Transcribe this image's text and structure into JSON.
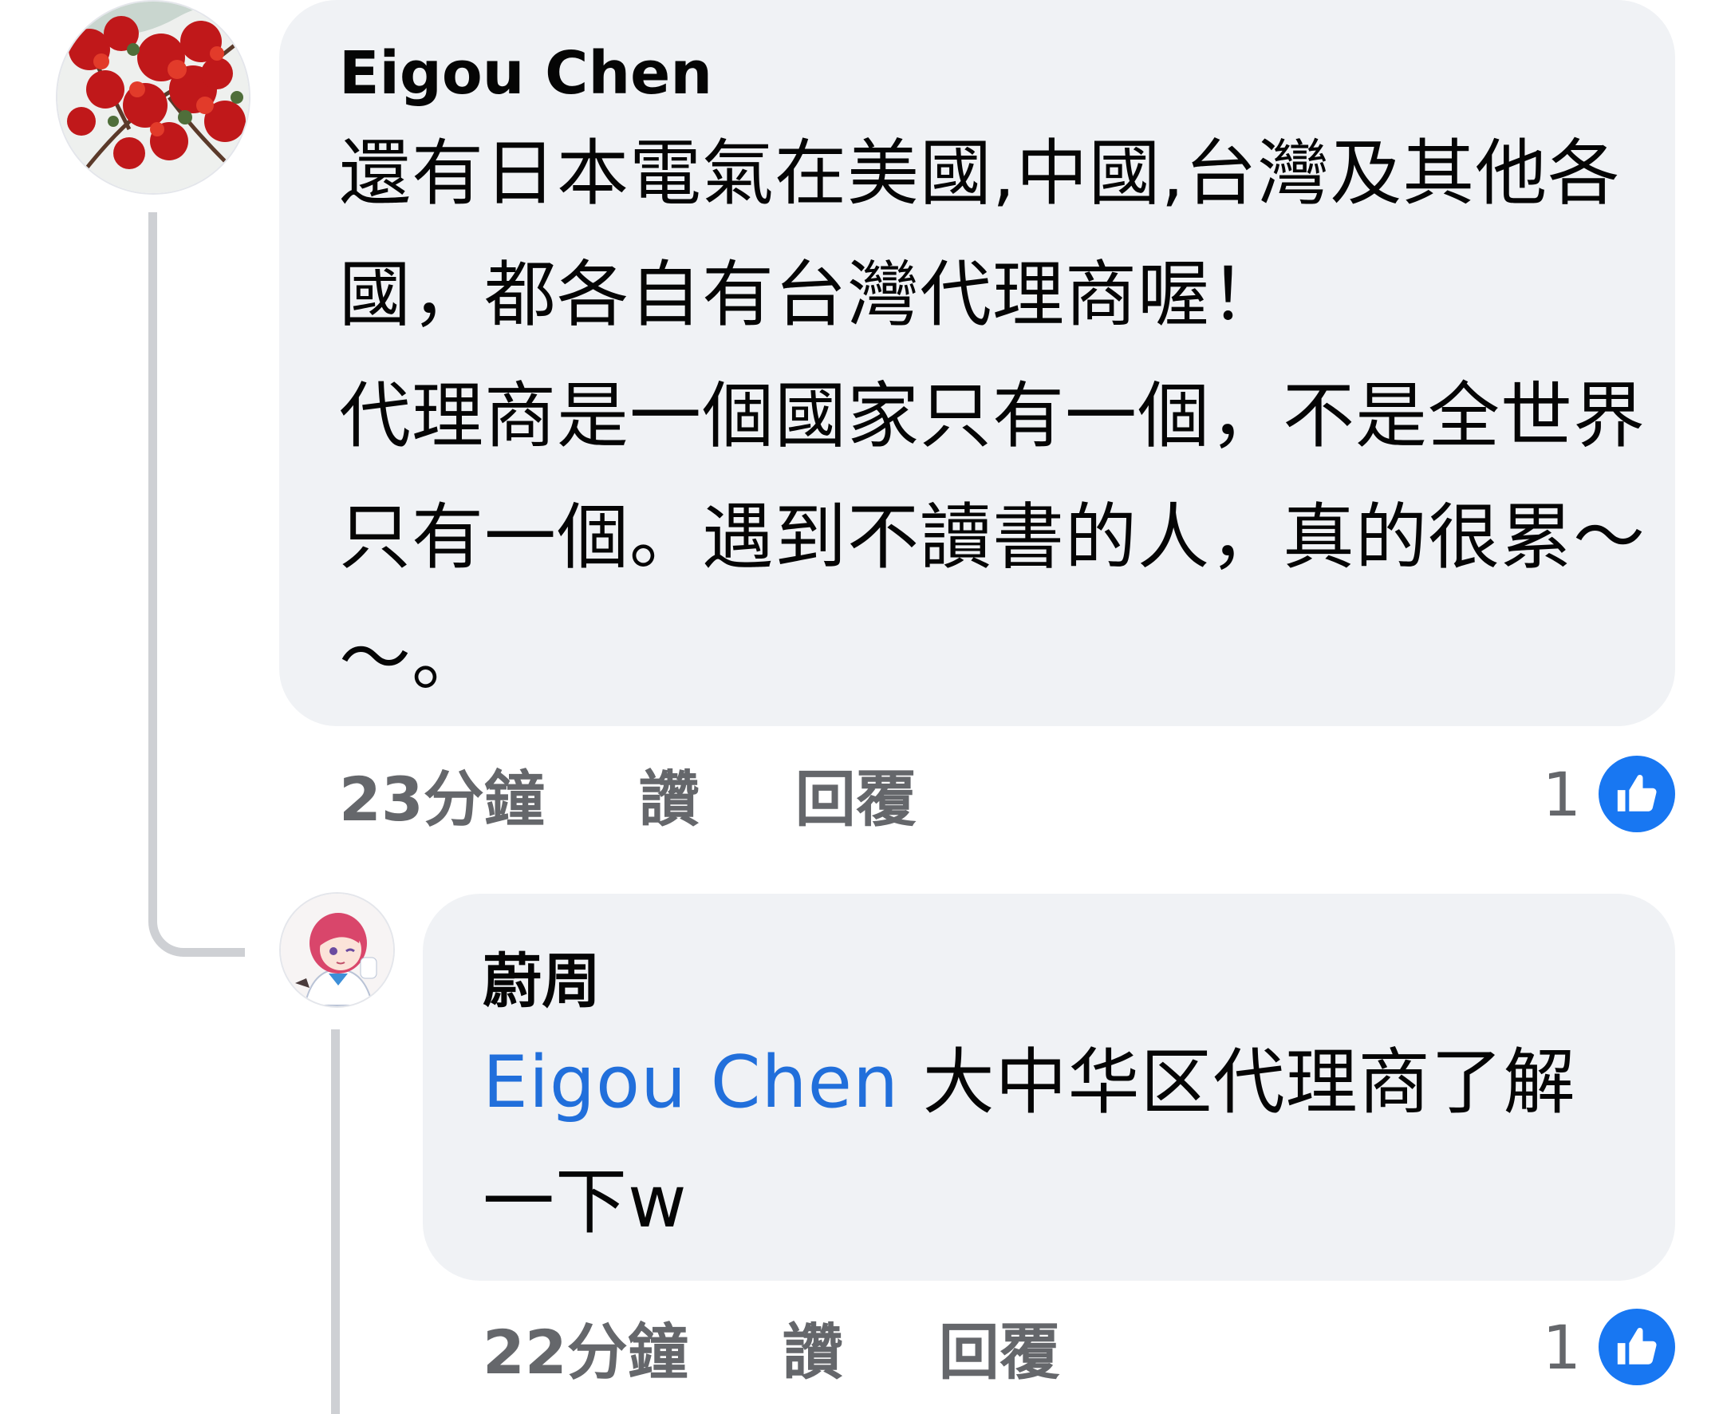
{
  "comment": {
    "author": "Eigou Chen",
    "text": "還有日本電氣在美國,中國,台灣及其他各國，都各自有台灣代理商喔！\n代理商是一個國家只有一個，不是全世界只有一個。遇到不讀書的人，真的很累～～。",
    "time": "23分鐘",
    "like_label": "讚",
    "reply_label": "回覆",
    "reaction_count": "1",
    "reaction_icon": "thumbs-up-icon",
    "reaction_color": "#1877f2"
  },
  "reply": {
    "author": "蔚周",
    "mention": "Eigou Chen",
    "text": " 大中华区代理商了解一下w",
    "time": "22分鐘",
    "like_label": "讚",
    "reply_label": "回覆",
    "reaction_count": "1",
    "reaction_icon": "thumbs-up-icon",
    "reaction_color": "#1877f2"
  },
  "colors": {
    "bubble": "#f0f2f5",
    "mention": "#216fdb",
    "meta_text": "#65676b",
    "thread_line": "#ced0d4"
  }
}
